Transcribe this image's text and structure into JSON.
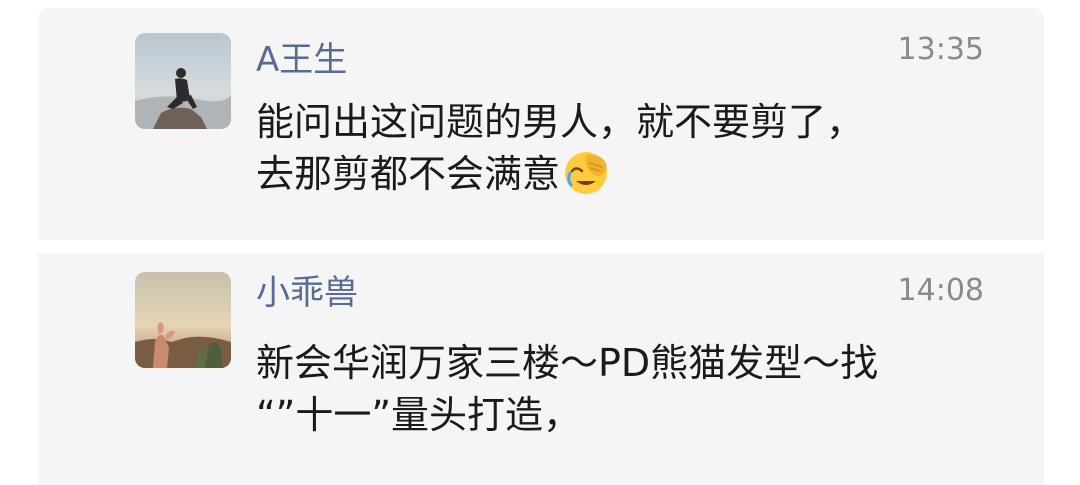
{
  "comments": [
    {
      "author": "A王生",
      "time": "13:35",
      "lines": [
        "能问出这问题的男人，就不要剪了，",
        "去那剪都不会满意"
      ],
      "emoji": "facepalm-laughing-emoji",
      "avatar": "avatar-man-on-rock"
    },
    {
      "author": "小乖兽",
      "time": "14:08",
      "lines": [
        "新会华润万家三楼～PD熊猫发型～找",
        "“”十一”量头打造，"
      ],
      "avatar": "avatar-sunset-hand-heart"
    }
  ],
  "icons": {
    "comment": "comment-bubble-icon"
  },
  "colors": {
    "author_link": "#576b95",
    "timestamp": "#8a8a8a",
    "card_background": "#f5f5f5",
    "body_text": "#1a1a1a"
  }
}
